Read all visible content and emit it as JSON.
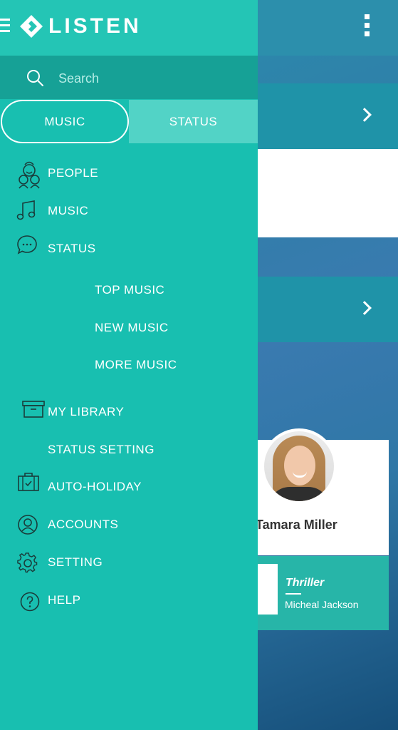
{
  "app": {
    "title": "LISTEN"
  },
  "search": {
    "placeholder": "Search"
  },
  "tabs": [
    {
      "label": "MUSIC",
      "active": true
    },
    {
      "label": "STATUS",
      "active": false
    }
  ],
  "menu": {
    "people": "PEOPLE",
    "music": "MUSIC",
    "status": "STATUS",
    "sub_top": "TOP MUSIC",
    "sub_new": "NEW MUSIC",
    "sub_more": "MORE MUSIC",
    "library": "MY LIBRARY",
    "status_setting": "STATUS SETTING",
    "auto_holiday": "AUTO-HOLIDAY",
    "accounts": "ACCOUNTS",
    "setting": "SETTING",
    "help": "HELP"
  },
  "profile": {
    "name": "Tamara Miller"
  },
  "track": {
    "title": "Thriller",
    "artist": "Micheal Jackson"
  },
  "colors": {
    "drawer": "#18bfb0",
    "search_bar": "#16a196",
    "tab_inactive": "#52d3c6",
    "track_card": "#27b5a8"
  },
  "icons": {
    "people": "people-icon",
    "music": "music-note-icon",
    "status": "chat-bubble-icon",
    "library": "archive-box-icon",
    "auto_holiday": "suitcase-icon",
    "accounts": "account-circle-icon",
    "setting": "gear-icon",
    "help": "help-icon"
  }
}
